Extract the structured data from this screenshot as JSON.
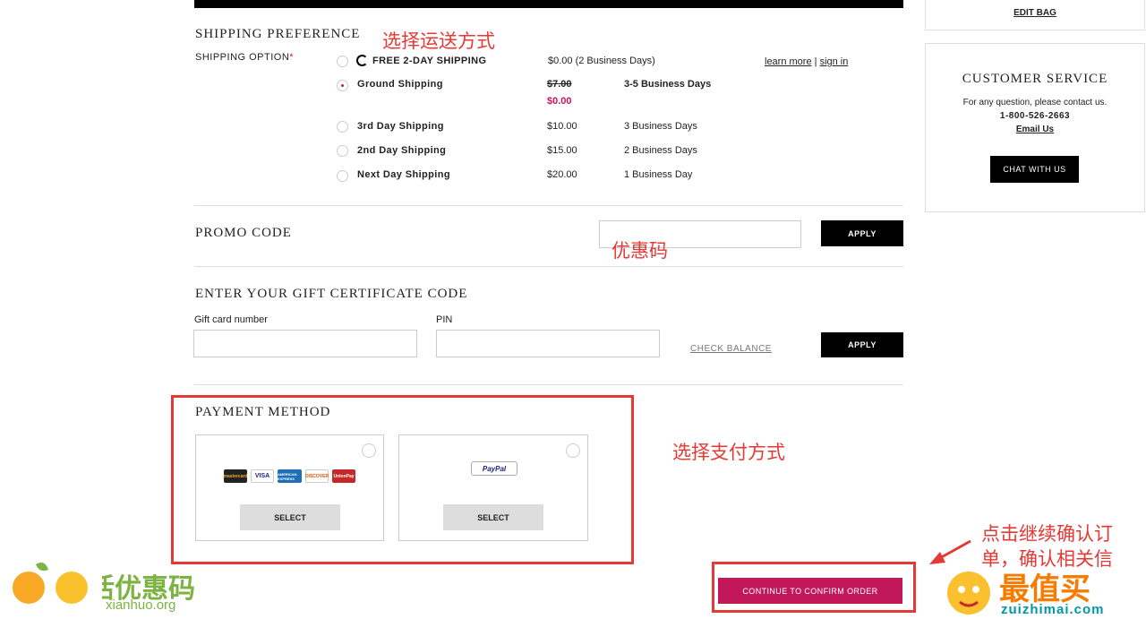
{
  "header": {
    "edit_bag": "EDIT BAG"
  },
  "shipping": {
    "title": "SHIPPING PREFERENCE",
    "option_label": "SHIPPING OPTION",
    "required_mark": "*",
    "learn_more": "learn more",
    "separator": "|",
    "sign_in": "sign in",
    "options": [
      {
        "name": "FREE 2-DAY SHIPPING",
        "price": "$0.00 (2 Business Days)",
        "days": "",
        "selected": false
      },
      {
        "name": "Ground Shipping",
        "old_price": "$7.00",
        "price": "$0.00",
        "days": "3-5 Business Days",
        "selected": true
      },
      {
        "name": "3rd Day Shipping",
        "price": "$10.00",
        "days": "3 Business Days",
        "selected": false
      },
      {
        "name": "2nd Day Shipping",
        "price": "$15.00",
        "days": "2 Business Days",
        "selected": false
      },
      {
        "name": "Next Day Shipping",
        "price": "$20.00",
        "days": "1 Business Day",
        "selected": false
      }
    ]
  },
  "promo": {
    "title": "PROMO CODE",
    "input_value": "",
    "apply": "APPLY"
  },
  "gift": {
    "title": "ENTER YOUR GIFT CERTIFICATE CODE",
    "card_label": "Gift card number",
    "pin_label": "PIN",
    "check_balance": "CHECK BALANCE",
    "apply": "APPLY"
  },
  "payment": {
    "title": "PAYMENT METHOD",
    "select": "SELECT",
    "card_logos": [
      "mastercard",
      "VISA",
      "AMERICAN EXPRESS",
      "DISCOVER",
      "UnionPay"
    ],
    "paypal": "PayPal"
  },
  "continue_button": "CONTINUE TO CONFIRM ORDER",
  "customer_service": {
    "title": "CUSTOMER SERVICE",
    "text": "For any question, please contact us.",
    "phone": "1-800-526-2663",
    "email": "Email Us",
    "chat": "CHAT WITH US"
  },
  "annotations": {
    "shipping": "选择运送方式",
    "promo": "优惠码",
    "payment": "选择支付方式",
    "continue": "点击继续确认订单，确认相关信"
  },
  "watermarks": {
    "left_cn": "鲜活优惠码",
    "left_url": "xianhuo.org",
    "right_cn": "最值买",
    "right_url": "zuizhimai.com"
  },
  "colors": {
    "accent": "#c2185b",
    "annotation": "#e53935",
    "continue_bg": "#c2185b"
  }
}
